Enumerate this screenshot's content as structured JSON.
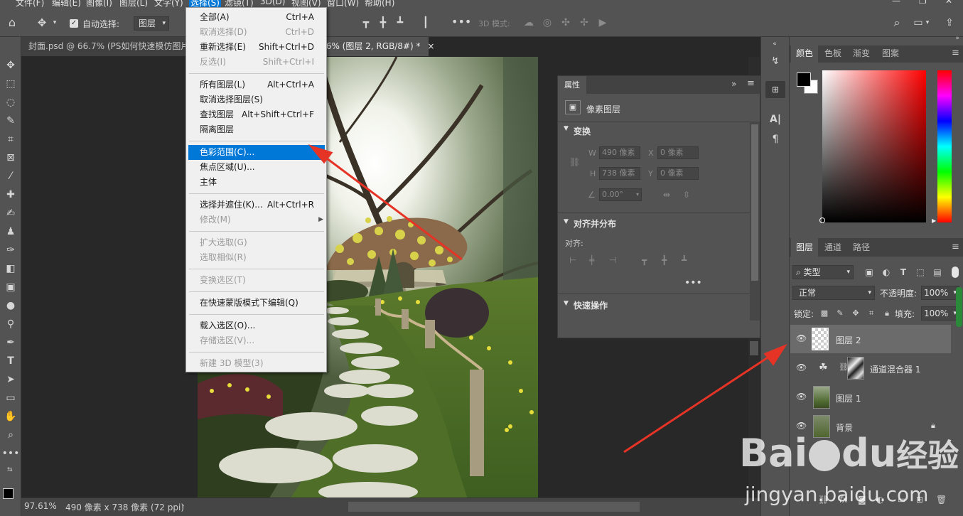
{
  "menubar": {
    "items": [
      "文件(F)",
      "编辑(E)",
      "图像(I)",
      "图层(L)",
      "文字(Y)",
      "选择(S)",
      "滤镜(T)",
      "3D(D)",
      "视图(V)",
      "窗口(W)",
      "帮助(H)"
    ]
  },
  "options": {
    "auto_select_label": "自动选择:",
    "auto_select_value": "图层",
    "mode3d_label": "3D 模式:"
  },
  "doc": {
    "tab1": "封面.psd @ 66.7% (PS如何快速模仿图片色",
    "tab2": ".6% (图层 2, RGB/8#) *",
    "tab2_close": "×"
  },
  "status": {
    "zoom": "97.61%",
    "size": "490 像素 x 738 像素 (72 ppi)"
  },
  "select_menu": {
    "items": [
      {
        "label": "全部(A)",
        "shortcut": "Ctrl+A",
        "disabled": false,
        "highlight": false
      },
      {
        "label": "取消选择(D)",
        "shortcut": "Ctrl+D",
        "disabled": true,
        "highlight": false
      },
      {
        "label": "重新选择(E)",
        "shortcut": "Shift+Ctrl+D",
        "disabled": false,
        "highlight": false
      },
      {
        "label": "反选(I)",
        "shortcut": "Shift+Ctrl+I",
        "disabled": true,
        "highlight": false
      },
      {
        "label": "所有图层(L)",
        "shortcut": "Alt+Ctrl+A",
        "disabled": false,
        "highlight": false
      },
      {
        "label": "取消选择图层(S)",
        "shortcut": "",
        "disabled": false,
        "highlight": false
      },
      {
        "label": "查找图层",
        "shortcut": "Alt+Shift+Ctrl+F",
        "disabled": false,
        "highlight": false
      },
      {
        "label": "隔离图层",
        "shortcut": "",
        "disabled": false,
        "highlight": false
      },
      {
        "label": "色彩范围(C)...",
        "shortcut": "",
        "disabled": false,
        "highlight": true
      },
      {
        "label": "焦点区域(U)...",
        "shortcut": "",
        "disabled": false,
        "highlight": false
      },
      {
        "label": "主体",
        "shortcut": "",
        "disabled": false,
        "highlight": false
      },
      {
        "label": "选择并遮住(K)...",
        "shortcut": "Alt+Ctrl+R",
        "disabled": false,
        "highlight": false
      },
      {
        "label": "修改(M)",
        "shortcut": "",
        "disabled": true,
        "highlight": false
      },
      {
        "label": "扩大选取(G)",
        "shortcut": "",
        "disabled": true,
        "highlight": false
      },
      {
        "label": "选取相似(R)",
        "shortcut": "",
        "disabled": true,
        "highlight": false
      },
      {
        "label": "变换选区(T)",
        "shortcut": "",
        "disabled": true,
        "highlight": false
      },
      {
        "label": "在快速蒙版模式下编辑(Q)",
        "shortcut": "",
        "disabled": false,
        "highlight": false
      },
      {
        "label": "载入选区(O)...",
        "shortcut": "",
        "disabled": false,
        "highlight": false
      },
      {
        "label": "存储选区(V)...",
        "shortcut": "",
        "disabled": true,
        "highlight": false
      },
      {
        "label": "新建 3D 模型(3)",
        "shortcut": "",
        "disabled": true,
        "highlight": false
      }
    ]
  },
  "properties": {
    "tab": "属性",
    "layer_type": "像素图层",
    "transform": "变换",
    "w_label": "W",
    "w_value": "490 像素",
    "x_label": "X",
    "x_value": "0 像素",
    "h_label": "H",
    "h_value": "738 像素",
    "y_label": "Y",
    "y_value": "0 像素",
    "angle_value": "0.00°",
    "align_section": "对齐并分布",
    "align_label": "对齐:",
    "quick_actions": "快速操作"
  },
  "color_panel": {
    "tabs": [
      "颜色",
      "色板",
      "渐变",
      "图案"
    ]
  },
  "layers_panel": {
    "tabs": [
      "图层",
      "通道",
      "路径"
    ],
    "filter": "类型",
    "blend_mode": "正常",
    "opacity_label": "不透明度:",
    "opacity_value": "100%",
    "lock_label": "锁定:",
    "fill_label": "填充:",
    "fill_value": "100%",
    "layers": [
      {
        "name": "图层 2"
      },
      {
        "name": "通道混合器 1"
      },
      {
        "name": "图层 1"
      },
      {
        "name": "背景"
      }
    ]
  },
  "watermark": {
    "brand": "Bai",
    "du": "du",
    "jingyan": "经验",
    "url": "jingyan.baidu.com"
  }
}
